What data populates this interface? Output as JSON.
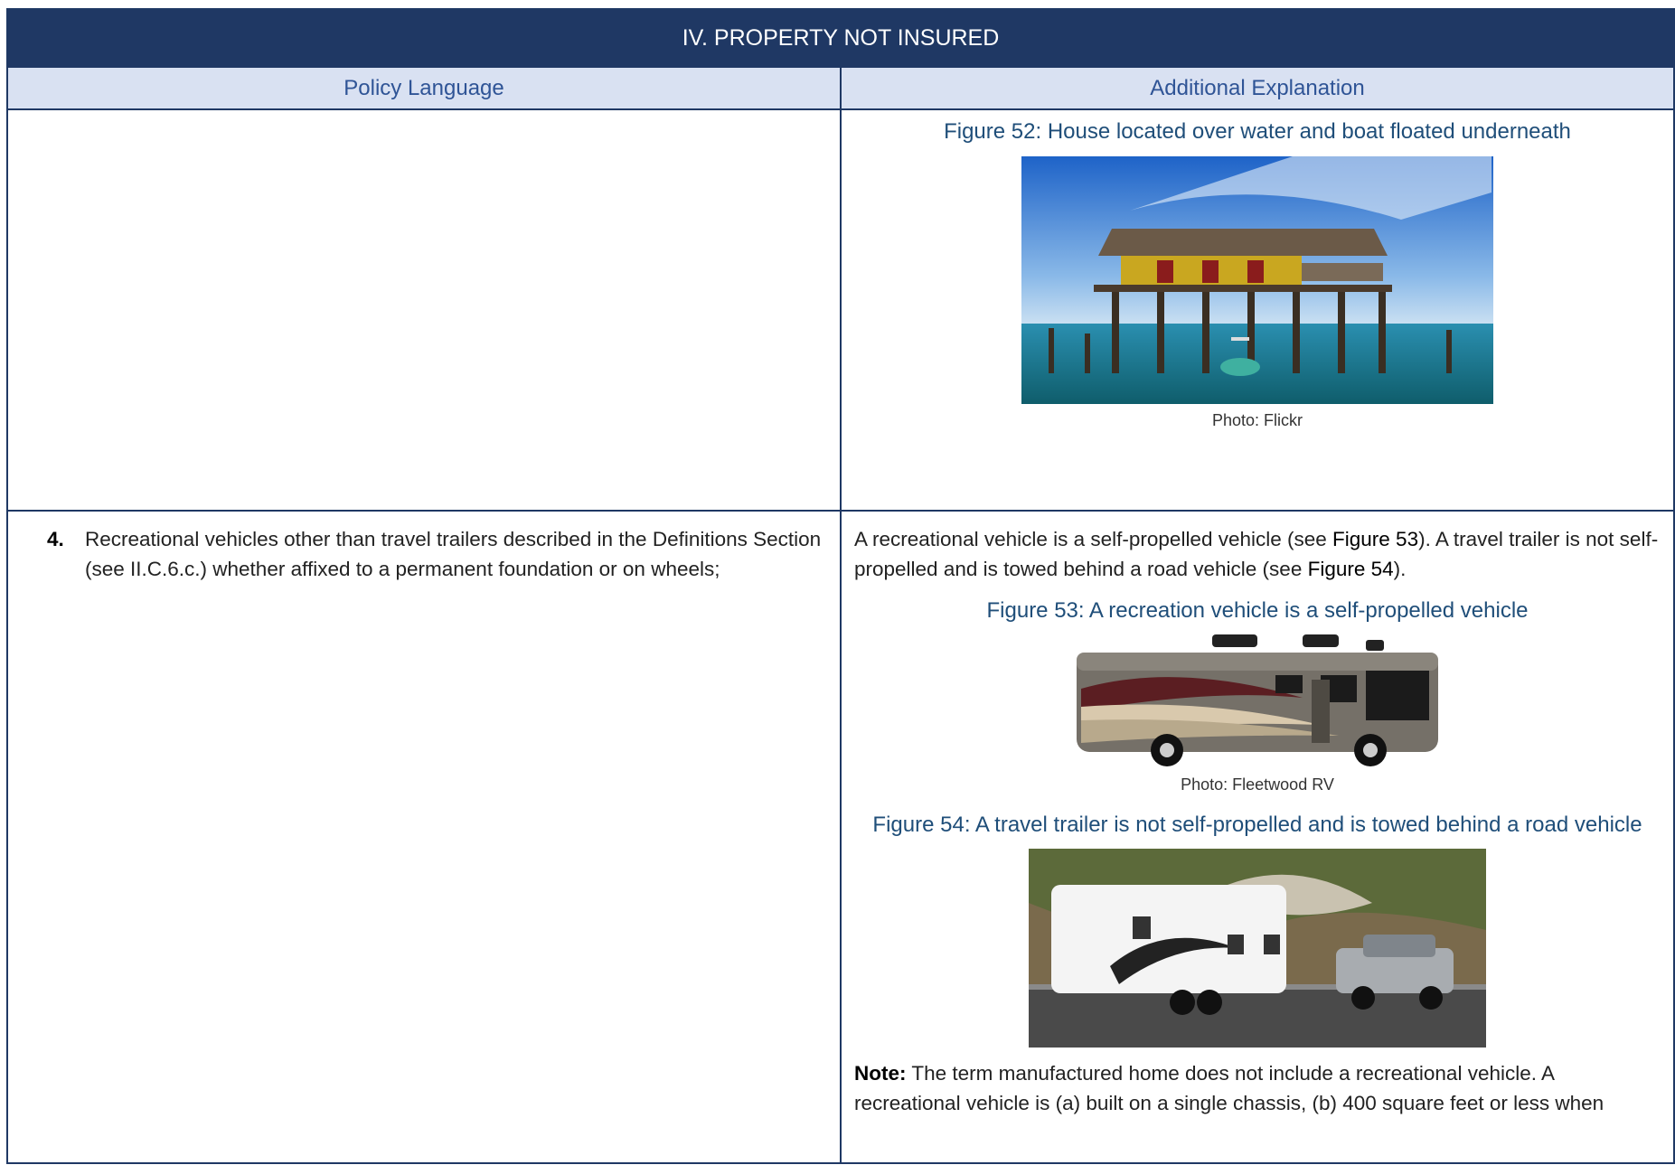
{
  "header": {
    "title": "IV. PROPERTY NOT INSURED",
    "col_left": "Policy Language",
    "col_right": "Additional Explanation"
  },
  "row1": {
    "figure_caption": "Figure 52: House located over water and boat floated underneath",
    "photo_credit": "Photo: Flickr"
  },
  "row2": {
    "item_number": "4.",
    "item_text": "Recreational vehicles other than travel trailers described in the Definitions Section (see II.C.6.c.) whether affixed to a permanent foundation or on wheels;",
    "explanation_part1": "A recreational vehicle is a self-propelled vehicle (see ",
    "explanation_ref1": "Figure 53",
    "explanation_part2": "). A travel trailer is not self-propelled and is towed behind a road vehicle (see ",
    "explanation_ref2": "Figure 54",
    "explanation_part3": ").",
    "figure53_caption": "Figure 53: A recreation vehicle is a self-propelled vehicle",
    "figure53_credit": "Photo: Fleetwood RV",
    "figure54_caption": "Figure 54: A travel trailer is not self-propelled and is towed behind a road vehicle",
    "note_label": "Note:",
    "note_text": " The term manufactured home does not include a recreational vehicle. A recreational vehicle is (a) built on a single chassis, (b) 400 square feet or less when"
  }
}
